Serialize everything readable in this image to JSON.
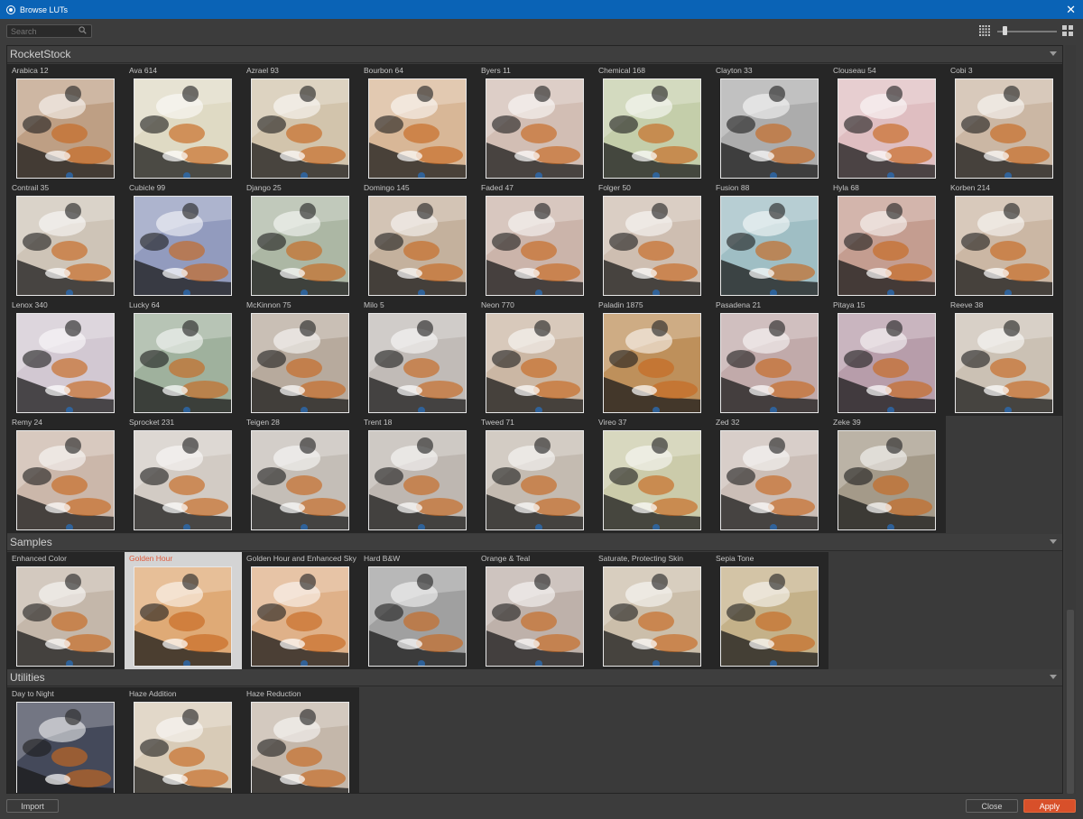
{
  "window": {
    "title": "Browse LUTs",
    "close_glyph": "✕"
  },
  "toolbar": {
    "search_placeholder": "Search",
    "zoom_level": 0.1
  },
  "sections": [
    {
      "name": "RocketStock",
      "items": [
        {
          "label": "Arabica 12",
          "tint": "#b08a6a"
        },
        {
          "label": "Ava 614",
          "tint": "#d8d2b8"
        },
        {
          "label": "Azrael 93",
          "tint": "#c8b89a"
        },
        {
          "label": "Bourbon 64",
          "tint": "#d0a880"
        },
        {
          "label": "Byers 11",
          "tint": "#c8b0a4"
        },
        {
          "label": "Chemical 168",
          "tint": "#b8c498"
        },
        {
          "label": "Clayton 33",
          "tint": "#9a9a9a"
        },
        {
          "label": "Clouseau 54",
          "tint": "#d8b0b4"
        },
        {
          "label": "Cobi 3",
          "tint": "#c0a890"
        },
        {
          "label": "Contrail 35",
          "tint": "#c4b8a8"
        },
        {
          "label": "Cubicle 99",
          "tint": "#7a86b0"
        },
        {
          "label": "Django 25",
          "tint": "#9aa890"
        },
        {
          "label": "Domingo 145",
          "tint": "#b8a088"
        },
        {
          "label": "Faded 47",
          "tint": "#c0a498"
        },
        {
          "label": "Folger 50",
          "tint": "#c4b0a0"
        },
        {
          "label": "Fusion 88",
          "tint": "#8ab0b8"
        },
        {
          "label": "Hyla 68",
          "tint": "#b88878"
        },
        {
          "label": "Korben 214",
          "tint": "#c0a890"
        },
        {
          "label": "Lenox 340",
          "tint": "#c8bcc8"
        },
        {
          "label": "Lucky 64",
          "tint": "#8aa088"
        },
        {
          "label": "McKinnon 75",
          "tint": "#a89888"
        },
        {
          "label": "Milo 5",
          "tint": "#b4aca8"
        },
        {
          "label": "Neon 770",
          "tint": "#c0a890"
        },
        {
          "label": "Paladin 1875",
          "tint": "#b07838"
        },
        {
          "label": "Pasadena 21",
          "tint": "#b49898"
        },
        {
          "label": "Pitaya 15",
          "tint": "#a88898"
        },
        {
          "label": "Reeve 38",
          "tint": "#c0b4a4"
        },
        {
          "label": "Remy 24",
          "tint": "#c0a898"
        },
        {
          "label": "Sprocket 231",
          "tint": "#c8c0b8"
        },
        {
          "label": "Teigen 28",
          "tint": "#b8b0a8"
        },
        {
          "label": "Trent 18",
          "tint": "#b0a8a0"
        },
        {
          "label": "Tweed 71",
          "tint": "#b8aca0"
        },
        {
          "label": "Vireo 37",
          "tint": "#c0c098"
        },
        {
          "label": "Zed 32",
          "tint": "#c0b0a8"
        },
        {
          "label": "Zeke 39",
          "tint": "#908470"
        }
      ]
    },
    {
      "name": "Samples",
      "items": [
        {
          "label": "Enhanced Color",
          "tint": "#b8a898"
        },
        {
          "label": "Golden Hour",
          "tint": "#d89858",
          "selected": true
        },
        {
          "label": "Golden Hour and Enhanced Sky",
          "tint": "#d8a070"
        },
        {
          "label": "Hard B&W",
          "tint": "#8c8c8c"
        },
        {
          "label": "Orange & Teal",
          "tint": "#b0a098"
        },
        {
          "label": "Saturate, Protecting Skin",
          "tint": "#c0b098"
        },
        {
          "label": "Sepia Tone",
          "tint": "#b8a070"
        }
      ]
    },
    {
      "name": "Utilities",
      "items": [
        {
          "label": "Day to Night",
          "tint": "#1c2236"
        },
        {
          "label": "Haze Addition",
          "tint": "#d0c0a8"
        },
        {
          "label": "Haze Reduction",
          "tint": "#b8a898"
        }
      ]
    }
  ],
  "footer": {
    "import_label": "Import",
    "close_label": "Close",
    "apply_label": "Apply"
  },
  "colors": {
    "titlebar": "#0a63b6",
    "apply": "#d8502a",
    "selected_label": "#e05a3c"
  }
}
